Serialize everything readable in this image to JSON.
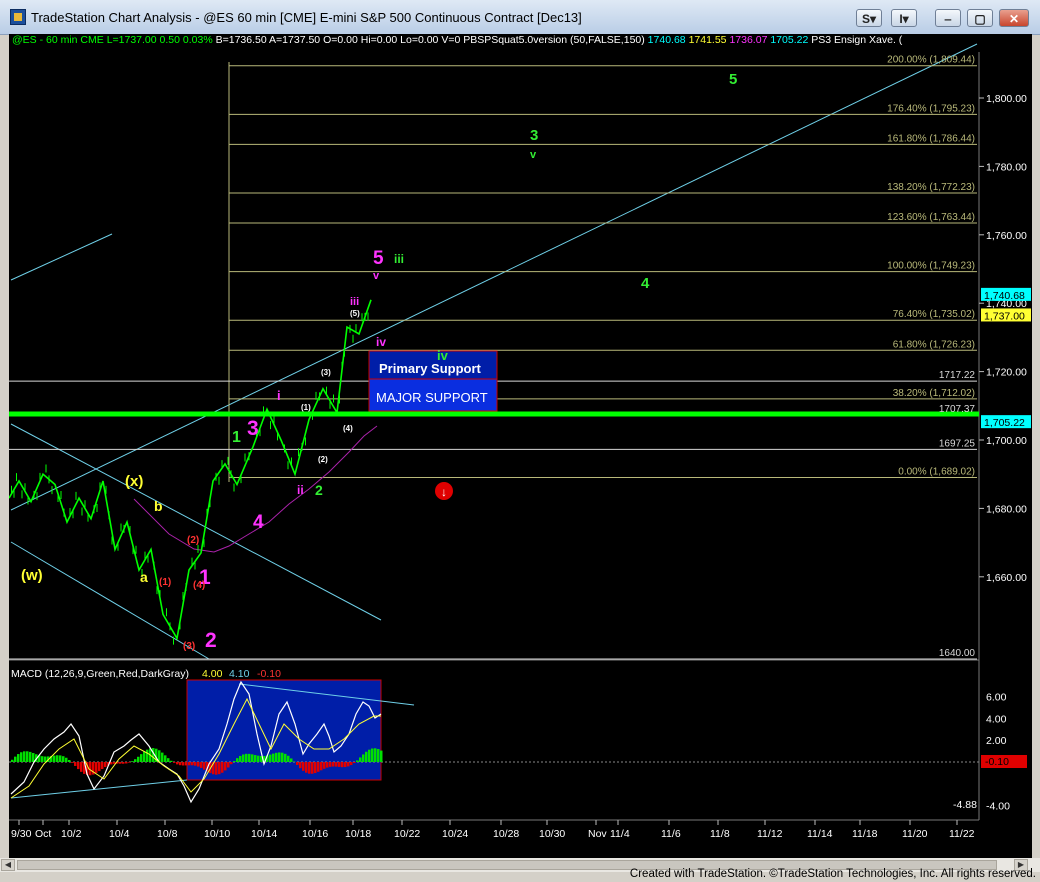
{
  "window": {
    "title": "TradeStation Chart Analysis - @ES 60 min [CME] E-mini S&P 500 Continuous Contract [Dec13]",
    "buttons": [
      "S",
      "I"
    ]
  },
  "info_line": {
    "symbol": "@ES - 60 min  CME",
    "last": "L=1737.00",
    "change": "0.50",
    "pct": "0.03%",
    "bid": "B=1736.50",
    "ask": "A=1737.50",
    "open": "O=0.00",
    "hi": "Hi=0.00",
    "lo": "Lo=0.00",
    "vol": "V=0",
    "indicator": "PBSPSquat5.0version (50,FALSE,150)",
    "ind_values": [
      "1740.68",
      "1741.55",
      "1736.07",
      "1705.22"
    ],
    "ind2": "PS3 Ensign Xave. ("
  },
  "colors": {
    "background": "#000000",
    "price": "#00ff00",
    "fib": "#b9b97a",
    "channel": "#6fd0e8",
    "support": "#00ff00",
    "magenta": "#ff33ff",
    "yellow": "#ffff33",
    "box": "#001ea8",
    "macd_up": "#00e000",
    "macd_down": "#e00000"
  },
  "chart_data": {
    "type": "line",
    "title": "@ES 60 min [CME] E-mini S&P 500 Continuous Contract [Dec13]",
    "xlabel": "",
    "ylabel": "",
    "ylim": [
      1637,
      1812
    ],
    "x_ticks": [
      "9/30",
      "Oct",
      "10/2",
      "10/4",
      "10/8",
      "10/10",
      "10/14",
      "10/16",
      "10/18",
      "10/22",
      "10/24",
      "10/28",
      "10/30",
      "Nov",
      "11/4",
      "11/6",
      "11/8",
      "11/12",
      "11/14",
      "11/18",
      "11/20",
      "11/22"
    ],
    "y_ticks": [
      1660,
      1680,
      1700,
      1720,
      1740,
      1760,
      1780,
      1800
    ],
    "y_tick_labels": [
      "1,660.00",
      "1,680.00",
      "1,700.00",
      "1,720.00",
      "1,740.00",
      "1,760.00",
      "1,780.00",
      "1,800.00"
    ],
    "series": [
      {
        "x": [
          "9/30",
          "9/30",
          "10/1",
          "10/1",
          "10/2",
          "10/2",
          "10/3",
          "10/3",
          "10/4",
          "10/4",
          "10/7",
          "10/7",
          "10/8",
          "10/8",
          "10/9",
          "10/9",
          "10/10",
          "10/10",
          "10/11",
          "10/11",
          "10/14",
          "10/14",
          "10/15",
          "10/15",
          "10/16",
          "10/16",
          "10/17",
          "10/17",
          "10/18",
          "10/18"
        ],
        "values": [
          1683,
          1688,
          1682,
          1690,
          1687,
          1676,
          1683,
          1677,
          1688,
          1668,
          1676,
          1662,
          1668,
          1649,
          1642,
          1662,
          1667,
          1688,
          1693,
          1687,
          1698,
          1709,
          1700,
          1690,
          1706,
          1715,
          1708,
          1733,
          1731,
          1741
        ]
      }
    ],
    "fib_levels": [
      {
        "label": "200.00% (1,809.44)",
        "value": 1809.44
      },
      {
        "label": "176.40% (1,795.23)",
        "value": 1795.23
      },
      {
        "label": "161.80% (1,786.44)",
        "value": 1786.44
      },
      {
        "label": "138.20% (1,772.23)",
        "value": 1772.23
      },
      {
        "label": "123.60% (1,763.44)",
        "value": 1763.44
      },
      {
        "label": "100.00% (1,749.23)",
        "value": 1749.23
      },
      {
        "label": "76.40% (1,735.02)",
        "value": 1735.02
      },
      {
        "label": "61.80% (1,726.23)",
        "value": 1726.23
      },
      {
        "label": "38.20% (1,712.02)",
        "value": 1712.02
      },
      {
        "label": "0.00% (1,689.02)",
        "value": 1689.02
      }
    ],
    "horizontal_lines": [
      {
        "label": "1717.22",
        "value": 1717.22
      },
      {
        "label": "1707.37",
        "value": 1707.37
      },
      {
        "label": "1697.25",
        "value": 1697.25
      },
      {
        "label": "1640.00",
        "value": 1640.0
      }
    ],
    "price_badges": [
      "1,740.68",
      "1,737.00",
      "1,705.22"
    ],
    "support_labels": [
      "Primary Support",
      "MAJOR SUPPORT"
    ],
    "wave_labels": [
      {
        "text": "5",
        "color": "green"
      },
      {
        "text": "3",
        "color": "green"
      },
      {
        "text": "v",
        "color": "green"
      },
      {
        "text": "4",
        "color": "green"
      },
      {
        "text": "iii",
        "color": "green"
      },
      {
        "text": "iv",
        "color": "green"
      },
      {
        "text": "5",
        "color": "magenta"
      },
      {
        "text": "v",
        "color": "magenta"
      },
      {
        "text": "iii",
        "color": "magenta"
      },
      {
        "text": "iv",
        "color": "magenta"
      },
      {
        "text": "(5)",
        "color": "white"
      },
      {
        "text": "(3)",
        "color": "white"
      },
      {
        "text": "(1)",
        "color": "white"
      },
      {
        "text": "(4)",
        "color": "white"
      },
      {
        "text": "(2)",
        "color": "white"
      },
      {
        "text": "i",
        "color": "magenta"
      },
      {
        "text": "ii",
        "color": "magenta"
      },
      {
        "text": "2",
        "color": "green"
      },
      {
        "text": "1",
        "color": "green"
      },
      {
        "text": "3",
        "color": "magenta"
      },
      {
        "text": "4",
        "color": "magenta"
      },
      {
        "text": "1",
        "color": "magenta"
      },
      {
        "text": "2",
        "color": "magenta"
      },
      {
        "text": "(x)",
        "color": "yellow"
      },
      {
        "text": "b",
        "color": "yellow"
      },
      {
        "text": "a",
        "color": "yellow"
      },
      {
        "text": "(w)",
        "color": "yellow"
      },
      {
        "text": "(2)",
        "color": "red"
      },
      {
        "text": "(1)",
        "color": "red"
      },
      {
        "text": "(4)",
        "color": "red"
      },
      {
        "text": "(3)",
        "color": "red"
      }
    ],
    "macd": {
      "title": "MACD (12,26,9,Green,Red,DarkGray)",
      "values_text": [
        "4.00",
        "4.10",
        "-0.10"
      ],
      "y_ticks": [
        -4.0,
        2.0,
        4.0,
        6.0
      ],
      "y_tick_labels": [
        "-4.00",
        "2.00",
        "4.00",
        "6.00"
      ],
      "badges": [
        "-0.10",
        "-4.88"
      ],
      "ylim": [
        -5,
        7.5
      ]
    }
  },
  "footer": "Created with TradeStation. ©TradeStation Technologies, Inc. All rights reserved."
}
